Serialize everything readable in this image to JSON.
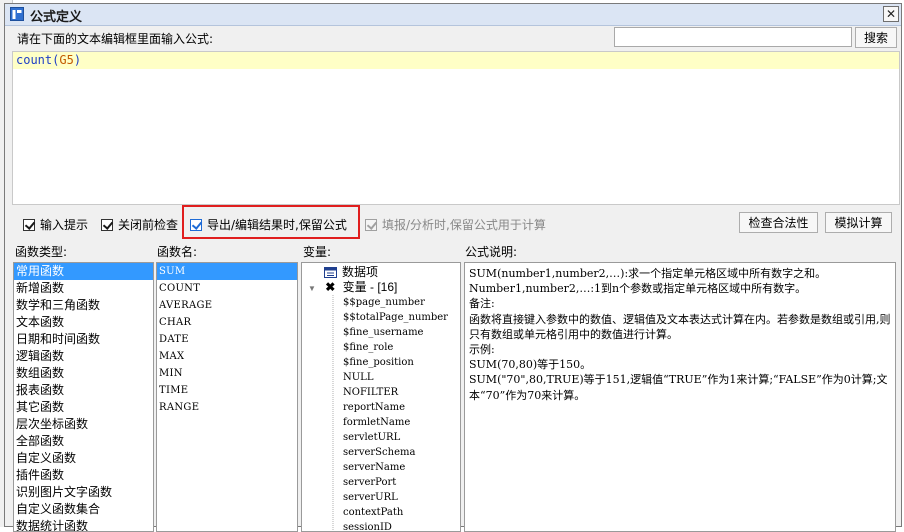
{
  "window": {
    "title": "公式定义",
    "close_glyph": "✕"
  },
  "prompt": {
    "label": "请在下面的文本编辑框里面输入公式:"
  },
  "search": {
    "value": "",
    "placeholder": "",
    "button_label": "搜索"
  },
  "editor": {
    "func": "count",
    "open": "(",
    "arg": "G5",
    "close": ")"
  },
  "options": {
    "input_hint": {
      "label": "输入提示",
      "checked": true
    },
    "check_before_close": {
      "label": "关闭前检查",
      "checked": true
    },
    "keep_formula_export": {
      "label": "导出/编辑结果时,保留公式",
      "checked": true
    },
    "keep_formula_fill": {
      "label": "填报/分析时,保留公式用于计算",
      "checked": true,
      "disabled": true
    }
  },
  "buttons": {
    "check_validity": "检查合法性",
    "simulate": "模拟计算"
  },
  "sections": {
    "categories": "函数类型:",
    "functions": "函数名:",
    "variables": "变量:",
    "description": "公式说明:"
  },
  "categories": [
    "常用函数",
    "新增函数",
    "数学和三角函数",
    "文本函数",
    "日期和时间函数",
    "逻辑函数",
    "数组函数",
    "报表函数",
    "其它函数",
    "层次坐标函数",
    "全部函数",
    "自定义函数",
    "插件函数",
    "识别图片文字函数",
    "自定义函数集合",
    "数据统计函数"
  ],
  "selected_category": "常用函数",
  "functions": [
    "SUM",
    "COUNT",
    "AVERAGE",
    "CHAR",
    "DATE",
    "MAX",
    "MIN",
    "TIME",
    "RANGE"
  ],
  "selected_function": "SUM",
  "variables": {
    "data_item": "数据项",
    "var_group": "变量 - [16]",
    "items": [
      "$$page_number",
      "$$totalPage_number",
      "$fine_username",
      "$fine_role",
      "$fine_position",
      "NULL",
      "NOFILTER",
      "reportName",
      "formletName",
      "servletURL",
      "serverSchema",
      "serverName",
      "serverPort",
      "serverURL",
      "contextPath",
      "sessionID"
    ]
  },
  "description": {
    "lines": [
      "SUM(number1,number2,…):求一个指定单元格区域中所有数字之和。",
      "Number1,number2,…:1到n个参数或指定单元格区域中所有数字。",
      "备注:",
      "函数将直接键入参数中的数值、逻辑值及文本表达式计算在内。若参数是数组或引用,则只有数组或单元格引用中的数值进行计算。",
      "示例:",
      "SUM(70,80)等于150。",
      "SUM(\"70\",80,TRUE)等于151,逻辑值“TRUE”作为1来计算;“FALSE”作为0计算;文本“70”作为70来计算。"
    ]
  },
  "colors": {
    "selection": "#3399ff",
    "highlight_line": "#ffffc6",
    "annotation_box": "#e01e1e"
  },
  "icons": {
    "title": "report-icon",
    "data_item": "table-icon",
    "var_group": "variable-icon"
  }
}
